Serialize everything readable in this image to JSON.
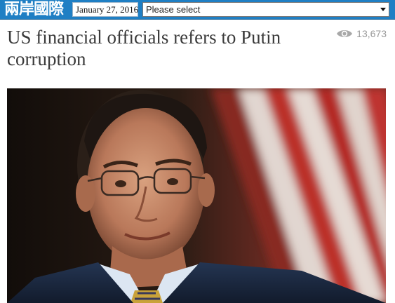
{
  "header": {
    "logo_text": "兩岸國際",
    "date": "January 27, 2016",
    "select": {
      "selected": "Please select"
    },
    "accent_color": "#1f7fc4"
  },
  "article": {
    "title": "US financial officials refers to Putin corruption",
    "views": "13,673",
    "views_icon": "eye-icon"
  }
}
